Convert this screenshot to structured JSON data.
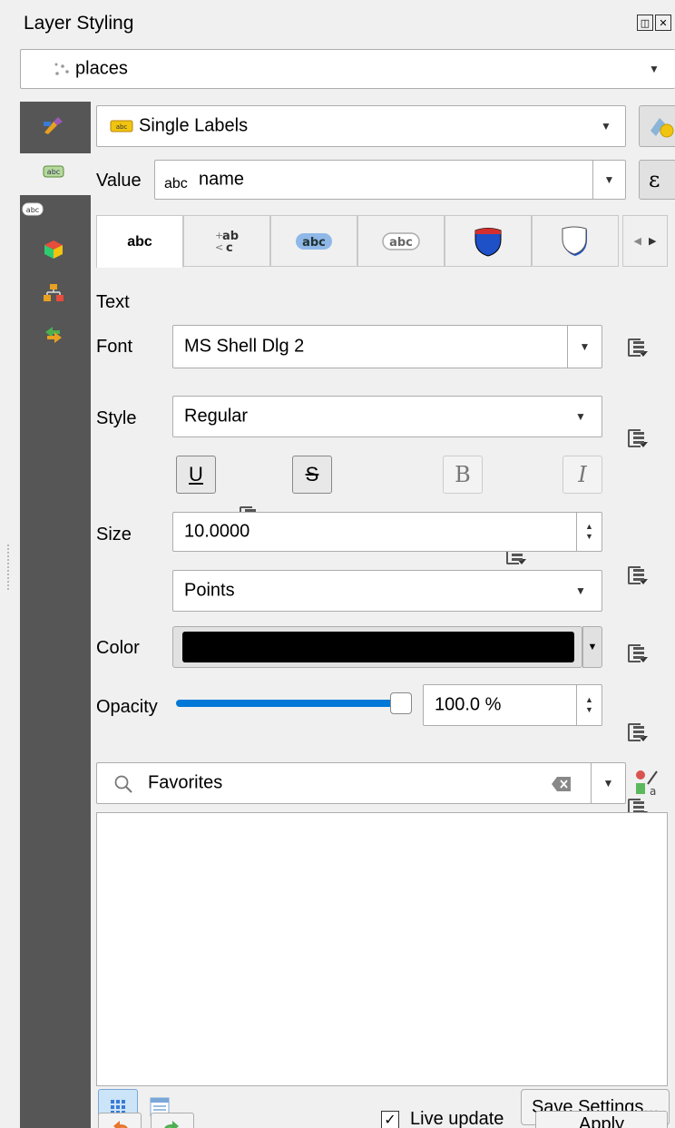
{
  "panel": {
    "title": "Layer Styling",
    "layer_name": "places"
  },
  "renderer": {
    "mode": "Single Labels",
    "value_label": "Value",
    "value_type": "abc",
    "value_field": "name"
  },
  "tabs": [
    {
      "name": "text",
      "glyph": "abc"
    },
    {
      "name": "formatting",
      "glyph": "+ab"
    },
    {
      "name": "buffer",
      "glyph": "abc"
    },
    {
      "name": "mask",
      "glyph": "abc"
    },
    {
      "name": "background",
      "glyph": ""
    },
    {
      "name": "shadow",
      "glyph": ""
    }
  ],
  "text_section": {
    "heading": "Text",
    "font_label": "Font",
    "font_value": "MS Shell Dlg 2",
    "style_label": "Style",
    "style_value": "Regular",
    "underline": "U",
    "strike": "S",
    "bold": "B",
    "italic": "I",
    "size_label": "Size",
    "size_value": "10.0000",
    "unit_value": "Points",
    "color_label": "Color",
    "color_value": "#000000",
    "opacity_label": "Opacity",
    "opacity_value": "100.0 %",
    "opacity_fraction": 1.0
  },
  "library": {
    "search_placeholder": "Favorites"
  },
  "footer": {
    "save_settings": "Save Settings...",
    "live_update_label": "Live update",
    "live_update_checked": true,
    "apply": "Apply"
  },
  "colors": {
    "sidebar": "#565656",
    "accent": "#0078d7"
  }
}
